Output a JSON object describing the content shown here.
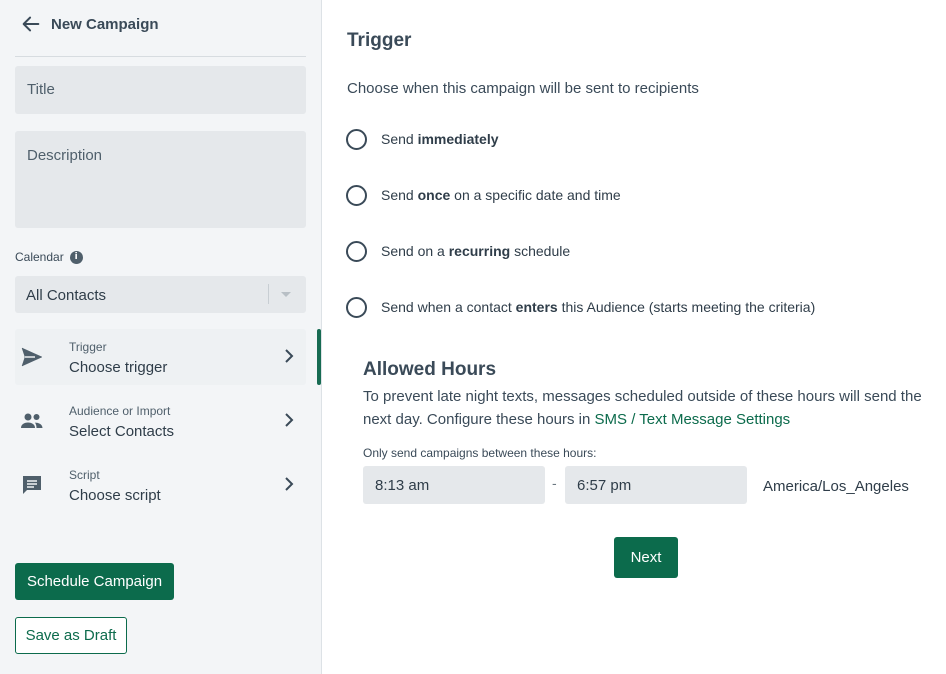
{
  "header": {
    "title": "New Campaign"
  },
  "form": {
    "title_placeholder": "Title",
    "description_placeholder": "Description",
    "calendar_label": "Calendar",
    "calendar_value": "All Contacts"
  },
  "steps": [
    {
      "label": "Trigger",
      "value": "Choose trigger",
      "icon": "send-icon",
      "active": true
    },
    {
      "label": "Audience or Import",
      "value": "Select Contacts",
      "icon": "people-icon",
      "active": false
    },
    {
      "label": "Script",
      "value": "Choose script",
      "icon": "message-icon",
      "active": false
    }
  ],
  "buttons": {
    "schedule": "Schedule Campaign",
    "draft": "Save as Draft",
    "next": "Next"
  },
  "trigger": {
    "title": "Trigger",
    "subtitle": "Choose when this campaign will be sent to recipients",
    "options": [
      {
        "pre": "Send ",
        "bold": "immediately",
        "post": ""
      },
      {
        "pre": "Send ",
        "bold": "once",
        "post": " on a specific date and time"
      },
      {
        "pre": "Send on a ",
        "bold": "recurring",
        "post": " schedule"
      },
      {
        "pre": "Send when a contact ",
        "bold": "enters",
        "post": " this Audience (starts meeting the criteria)"
      }
    ]
  },
  "allowed_hours": {
    "title": "Allowed Hours",
    "desc_prefix": "To prevent late night texts, messages scheduled outside of these hours will send the next day. Configure these hours in ",
    "link": "SMS / Text Message Settings",
    "small_label": "Only send campaigns between these hours:",
    "start": "8:13 am",
    "separator": "-",
    "end": "6:57 pm",
    "timezone": "America/Los_Angeles"
  },
  "colors": {
    "accent": "#0c6b4c",
    "sidebar_bg": "#f3f5f7",
    "field_bg": "#e5e8eb"
  }
}
